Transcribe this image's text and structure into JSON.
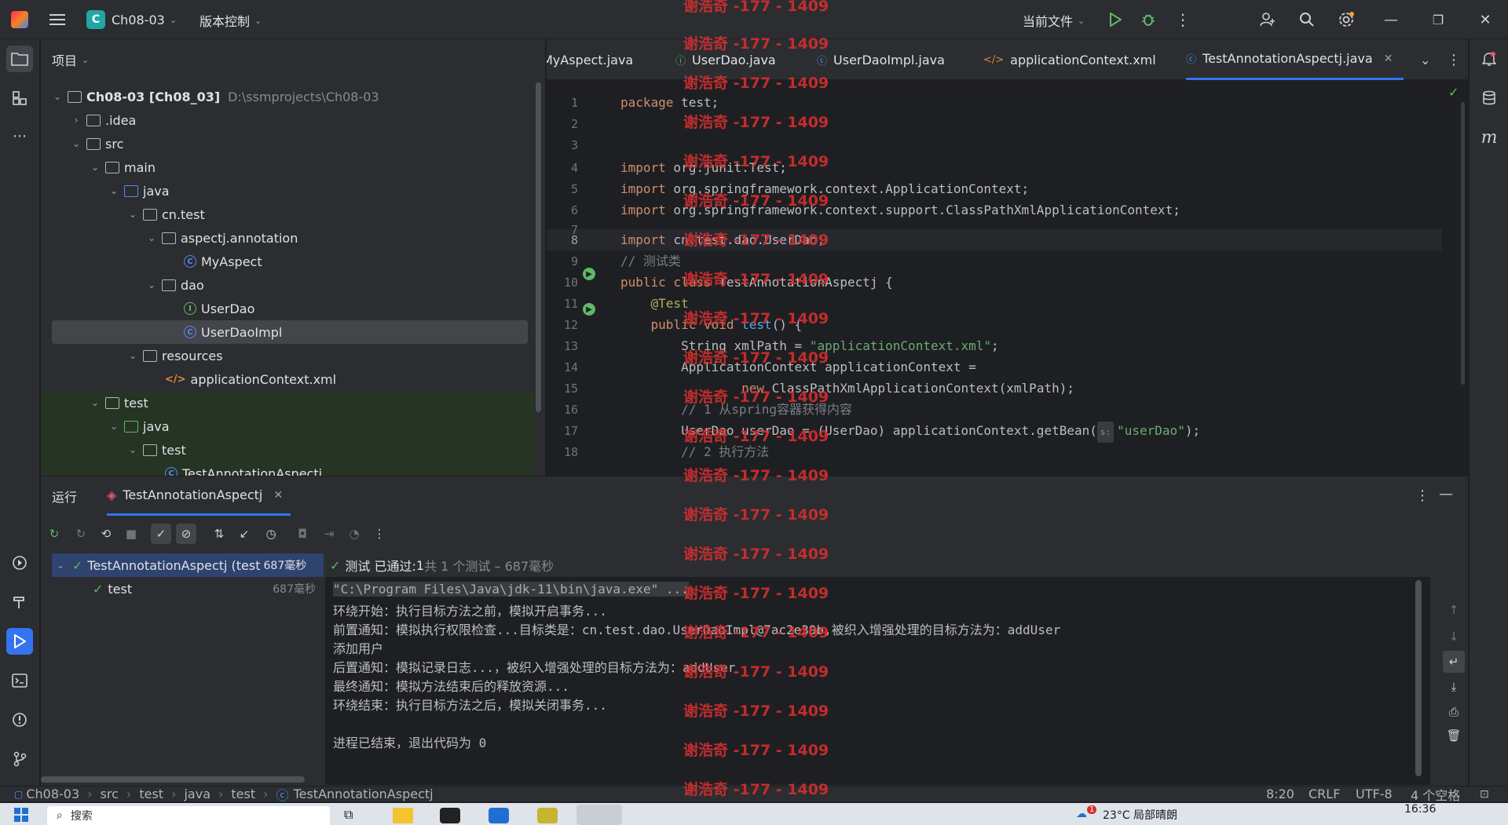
{
  "titlebar": {
    "project_badge": "C",
    "project_name": "Ch08-03",
    "vcs_menu": "版本控制",
    "run_config": "当前文件",
    "minimize": "—",
    "restore": "❐",
    "close": "✕"
  },
  "project_panel": {
    "title": "项目",
    "tree": [
      {
        "label": "Ch08-03 [Ch08_03]",
        "extra": "D:\\ssmprojects\\Ch08-03"
      },
      {
        "label": ".idea"
      },
      {
        "label": "src"
      },
      {
        "label": "main"
      },
      {
        "label": "java"
      },
      {
        "label": "cn.test"
      },
      {
        "label": "aspectj.annotation"
      },
      {
        "label": "MyAspect"
      },
      {
        "label": "dao"
      },
      {
        "label": "UserDao"
      },
      {
        "label": "UserDaoImpl"
      },
      {
        "label": "resources"
      },
      {
        "label": "applicationContext.xml"
      },
      {
        "label": "test"
      },
      {
        "label": "java"
      },
      {
        "label": "test"
      },
      {
        "label": "TestAnnotationAspectj"
      }
    ]
  },
  "editor": {
    "tabs": [
      {
        "label": "MyAspect.java"
      },
      {
        "label": "UserDao.java"
      },
      {
        "label": "UserDaoImpl.java"
      },
      {
        "label": "applicationContext.xml"
      },
      {
        "label": "TestAnnotationAspectj.java"
      }
    ],
    "line_numbers": [
      "1",
      "2",
      "3",
      "4",
      "5",
      "6",
      "7",
      "8",
      "9",
      "10",
      "11",
      "12",
      "13",
      "14",
      "15",
      "16",
      "17",
      "18"
    ],
    "code": {
      "l1a": "package",
      "l1b": " test;",
      "l4a": "import",
      "l4b": " org.junit.Test;",
      "l5a": "import",
      "l5b": " org.springframework.context.ApplicationContext;",
      "l6a": "import",
      "l6b": " org.springframework.context.support.ClassPathXmlApplicationContext;",
      "l8a": "import",
      "l8b": " cn.test.dao.UserDao;",
      "l9": "// 测试类",
      "l10a": "public class",
      "l10b": " TestAnnotationAspectj {",
      "l11": "    @Test",
      "l12a": "    public void ",
      "l12b": "test",
      "l12c": "() {",
      "l13a": "        String xmlPath = ",
      "l13b": "\"applicationContext.xml\"",
      "l13c": ";",
      "l14": "        ApplicationContext applicationContext =",
      "l15a": "                ",
      "l15b": "new",
      "l15c": " ClassPathXmlApplicationContext(xmlPath);",
      "l16": "        // 1 从spring容器获得内容",
      "l17a": "        UserDao userDao = (UserDao) applicationContext.getBean(",
      "l17hint": "s:",
      "l17b": "\"userDao\"",
      "l17c": ");",
      "l18": "        // 2 执行方法"
    }
  },
  "run_panel": {
    "title": "运行",
    "tab_label": "TestAnnotationAspectj",
    "summary_prefix": "测试 已通过: ",
    "summary_count": "1",
    "summary_rest": "共 1 个测试 – 687毫秒",
    "tests": [
      {
        "label": "TestAnnotationAspectj (test",
        "time": "687毫秒"
      },
      {
        "label": "test",
        "time": "687毫秒"
      }
    ],
    "console": [
      "\"C:\\Program Files\\Java\\jdk-11\\bin\\java.exe\" ...",
      "环绕开始：执行目标方法之前，模拟开启事务...",
      "前置通知：模拟执行权限检查...目标类是：cn.test.dao.UserDaoImpl@7ac2e39b,被织入增强处理的目标方法为：addUser",
      "添加用户",
      "后置通知：模拟记录日志...，被织入增强处理的目标方法为：addUser",
      "最终通知：模拟方法结束后的释放资源...",
      "环绕结束：执行目标方法之后，模拟关闭事务...",
      "",
      "进程已结束，退出代码为 0"
    ]
  },
  "statusbar": {
    "crumbs": [
      "Ch08-03",
      "src",
      "test",
      "java",
      "test",
      "TestAnnotationAspectj"
    ],
    "position": "8:20",
    "line_sep": "CRLF",
    "encoding": "UTF-8",
    "indent": "4 个空格"
  },
  "taskbar": {
    "search_placeholder": "搜索",
    "weather": "23°C 局部晴朗",
    "time": "16:36",
    "notification_count": "1"
  },
  "watermark": "谢浩奇 -177 - 1409",
  "colors": {
    "accent": "#3574f0",
    "pass_green": "#5fb865",
    "watermark_red": "#d32f2f"
  }
}
